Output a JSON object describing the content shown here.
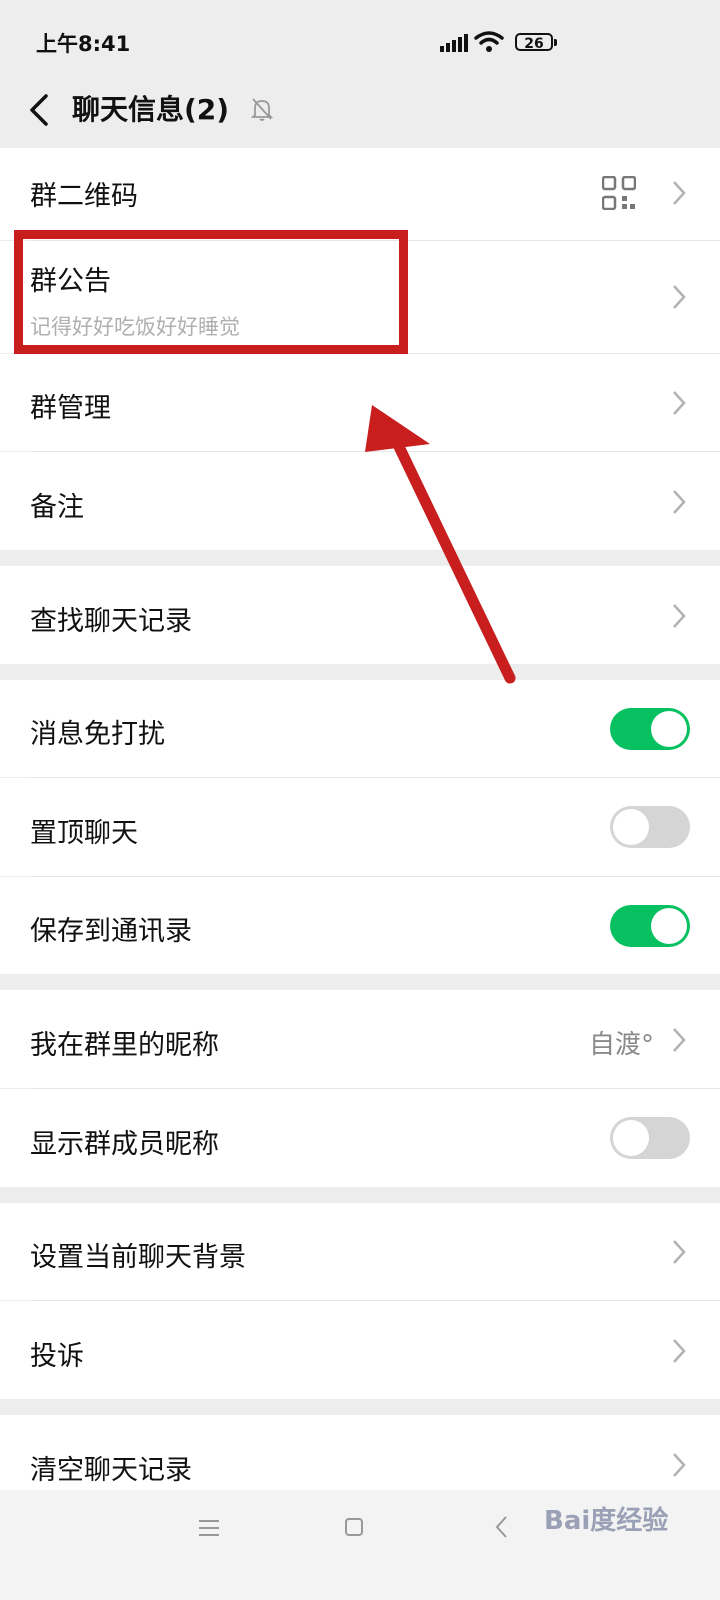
{
  "status": {
    "time": "上午8:41",
    "battery": "26"
  },
  "header": {
    "title": "聊天信息(2)"
  },
  "rows": {
    "qrcode": {
      "label": "群二维码"
    },
    "notice": {
      "label": "群公告",
      "sub": "记得好好吃饭好好睡觉"
    },
    "manage": {
      "label": "群管理"
    },
    "remark": {
      "label": "备注"
    },
    "search": {
      "label": "查找聊天记录"
    },
    "mute": {
      "label": "消息免打扰",
      "on": true
    },
    "pin": {
      "label": "置顶聊天",
      "on": false
    },
    "save": {
      "label": "保存到通讯录",
      "on": true
    },
    "nickname": {
      "label": "我在群里的昵称",
      "value": "自渡°"
    },
    "show_nick": {
      "label": "显示群成员昵称",
      "on": false
    },
    "background": {
      "label": "设置当前聊天背景"
    },
    "complain": {
      "label": "投诉"
    },
    "clear": {
      "label": "清空聊天记录"
    }
  },
  "watermark": {
    "text": "Bai度经验"
  },
  "colors": {
    "accent": "#07c160",
    "highlight": "#c81e1e"
  },
  "icons": [
    "back-arrow-icon",
    "mute-bell-icon",
    "qr-code-icon",
    "chevron-right-icon",
    "menu-icon",
    "home-icon",
    "back-icon"
  ]
}
